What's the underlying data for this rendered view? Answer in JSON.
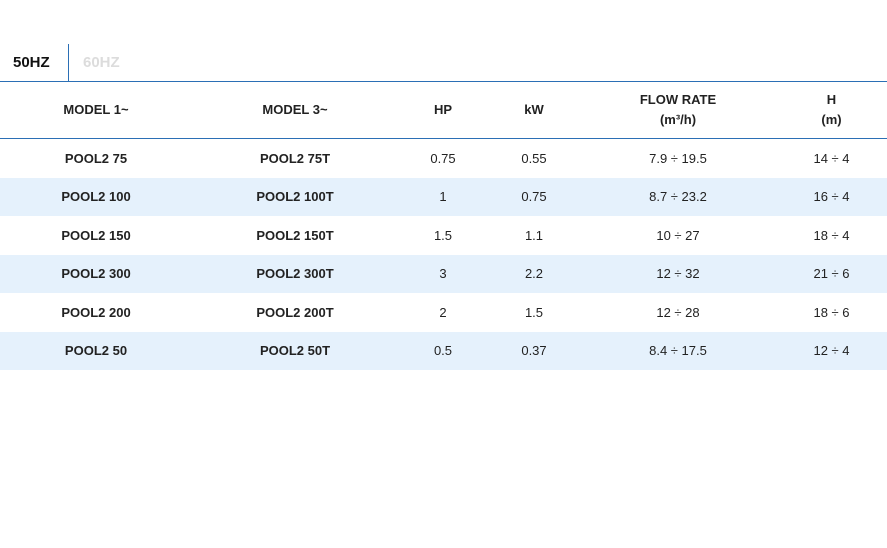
{
  "tabs": {
    "active": "50HZ",
    "inactive": "60HZ"
  },
  "colors": {
    "accent": "#2b6fb5",
    "stripe": "#e5f1fc",
    "inactive_tab": "#dcdcdc"
  },
  "table": {
    "headers": {
      "model1": "MODEL 1~",
      "model3": "MODEL 3~",
      "hp": "HP",
      "kw": "kW",
      "flow_line1": "FLOW RATE",
      "flow_line2": "(m³/h)",
      "h_line1": "H",
      "h_line2": "(m)"
    },
    "rows": [
      {
        "model1": "POOL2 75",
        "model3": "POOL2 75T",
        "hp": "0.75",
        "kw": "0.55",
        "flow": "7.9 ÷ 19.5",
        "h": "14 ÷ 4"
      },
      {
        "model1": "POOL2 100",
        "model3": "POOL2 100T",
        "hp": "1",
        "kw": "0.75",
        "flow": "8.7 ÷ 23.2",
        "h": "16 ÷ 4"
      },
      {
        "model1": "POOL2 150",
        "model3": "POOL2 150T",
        "hp": "1.5",
        "kw": "1.1",
        "flow": "10 ÷ 27",
        "h": "18 ÷ 4"
      },
      {
        "model1": "POOL2 300",
        "model3": "POOL2 300T",
        "hp": "3",
        "kw": "2.2",
        "flow": "12 ÷ 32",
        "h": "21 ÷ 6"
      },
      {
        "model1": "POOL2 200",
        "model3": "POOL2 200T",
        "hp": "2",
        "kw": "1.5",
        "flow": "12 ÷ 28",
        "h": "18 ÷ 6"
      },
      {
        "model1": "POOL2 50",
        "model3": "POOL2 50T",
        "hp": "0.5",
        "kw": "0.37",
        "flow": "8.4 ÷ 17.5",
        "h": "12 ÷ 4"
      }
    ]
  }
}
